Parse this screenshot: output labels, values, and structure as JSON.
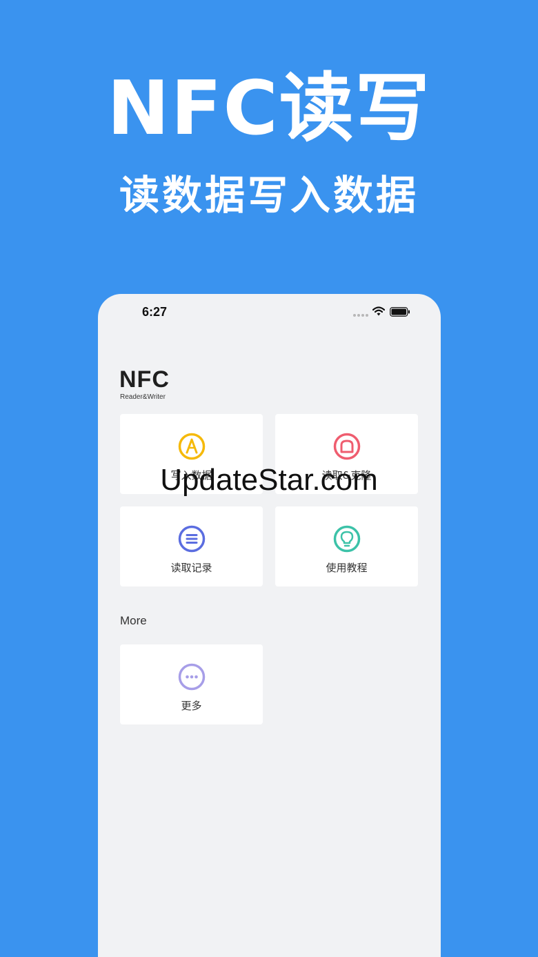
{
  "promo": {
    "title": "NFC读写",
    "subtitle": "读数据写入数据"
  },
  "status_bar": {
    "time": "6:27",
    "icons": [
      "signal-dots-icon",
      "wifi-icon",
      "battery-icon"
    ]
  },
  "logo": {
    "main": "NFC",
    "sub": "Reader&Writer"
  },
  "cards": [
    {
      "label": "写入数据",
      "icon": "write-pen-icon",
      "color": "#f5b90a"
    },
    {
      "label": "读取&克隆",
      "icon": "read-clone-icon",
      "color": "#ef5d6f"
    },
    {
      "label": "读取记录",
      "icon": "list-icon",
      "color": "#5b6de0"
    },
    {
      "label": "使用教程",
      "icon": "lightbulb-icon",
      "color": "#3cc2a8"
    }
  ],
  "more_section": {
    "title": "More",
    "cards": [
      {
        "label": "更多",
        "icon": "more-dots-icon",
        "color": "#a79ee8"
      }
    ]
  },
  "watermark": "UpdateStar.com",
  "colors": {
    "background": "#3a93ef",
    "phone_background": "#f1f2f4",
    "card_background": "#ffffff"
  }
}
